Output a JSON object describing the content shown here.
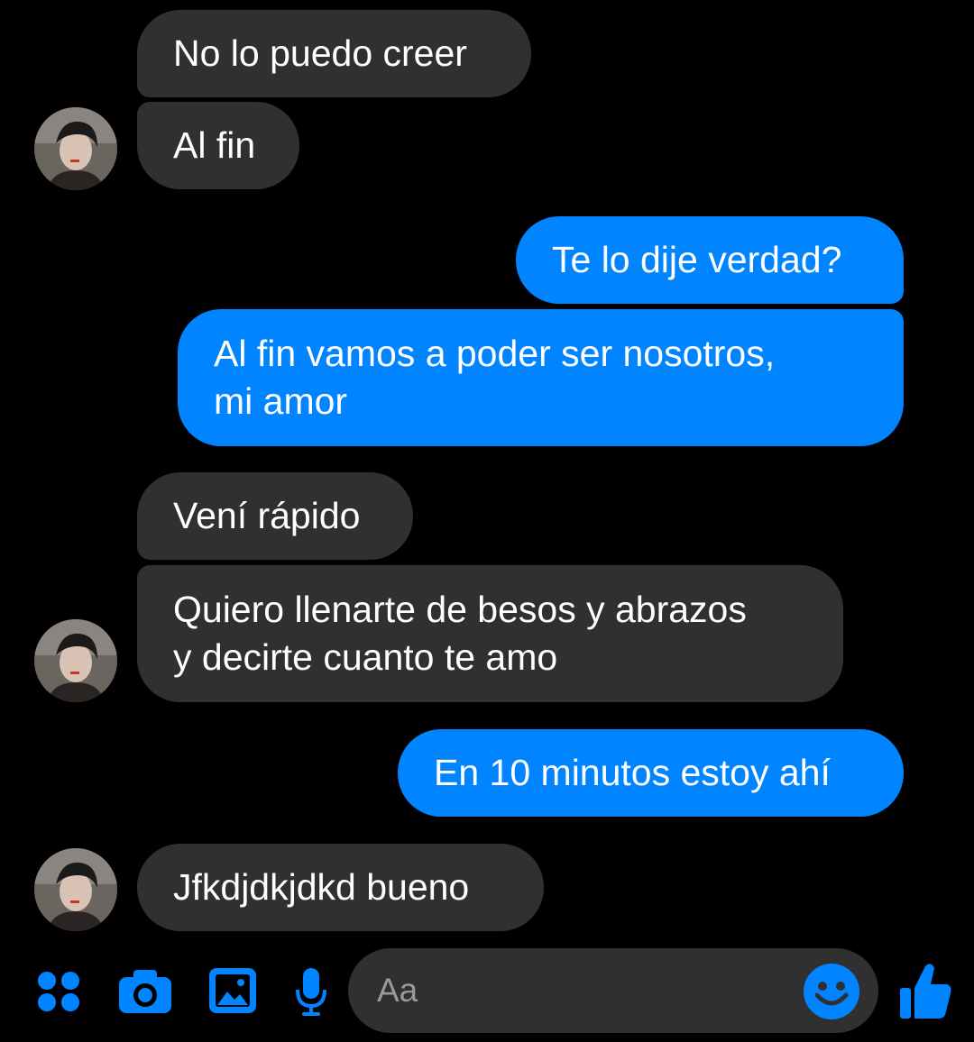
{
  "conversation": {
    "messages": [
      {
        "sender": "contact",
        "text": "No lo puedo creer"
      },
      {
        "sender": "contact",
        "text": "Al fin"
      },
      {
        "sender": "me",
        "text": "Te lo dije verdad?"
      },
      {
        "sender": "me",
        "text_line1": "Al fin vamos a poder ser nosotros,",
        "text_line2": "mi amor"
      },
      {
        "sender": "contact",
        "text": "Vení rápido"
      },
      {
        "sender": "contact",
        "text_line1": "Quiero llenarte de besos y abrazos",
        "text_line2": "y decirte cuanto te amo"
      },
      {
        "sender": "me",
        "text": "En 10 minutos estoy ahí"
      },
      {
        "sender": "contact",
        "text": "Jfkdjdkjdkd bueno"
      }
    ]
  },
  "composer": {
    "placeholder": "Aa",
    "icons": [
      "more-apps-icon",
      "camera-icon",
      "gallery-icon",
      "microphone-icon",
      "emoji-icon",
      "thumbs-up-icon"
    ]
  },
  "colors": {
    "background": "#000000",
    "incoming_bubble": "#303030",
    "outgoing_bubble": "#0084ff",
    "accent": "#0084ff",
    "text": "#ffffff",
    "placeholder": "#9a9a9a"
  }
}
